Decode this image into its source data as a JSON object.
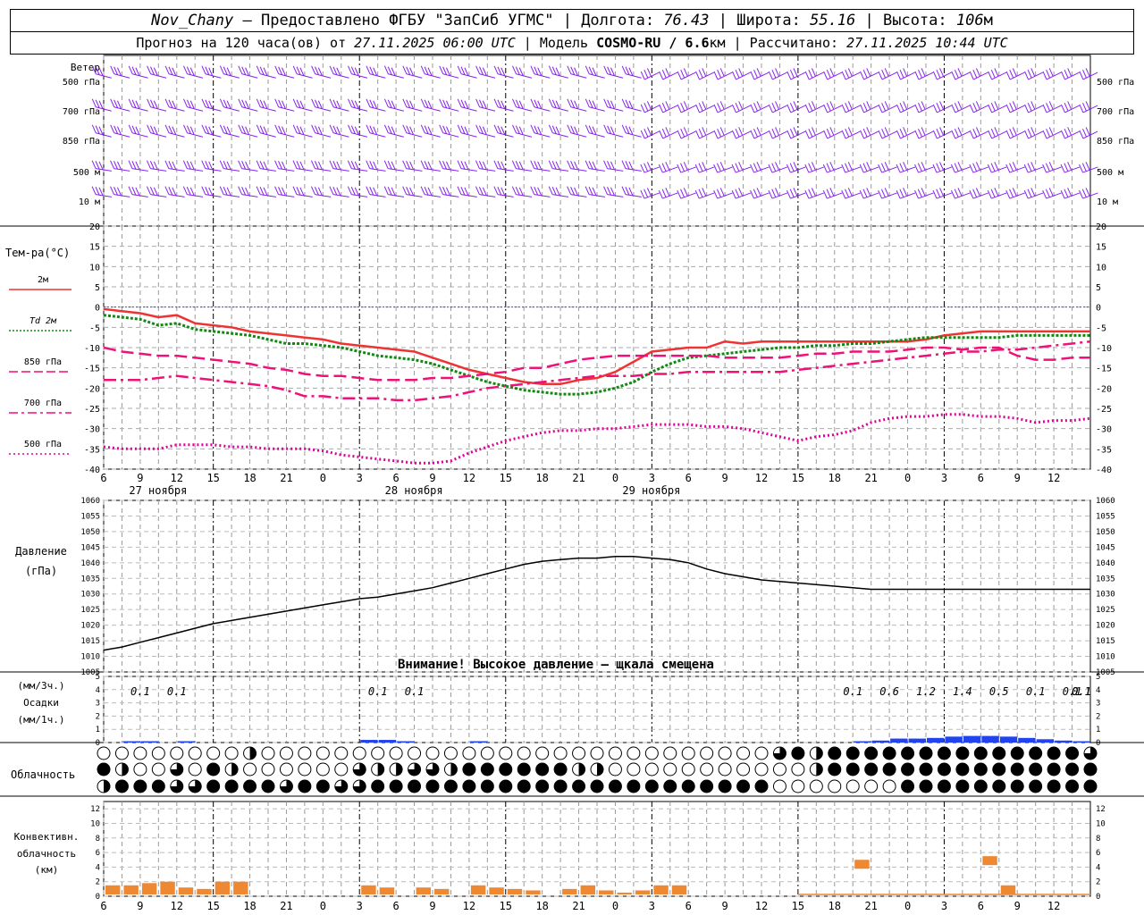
{
  "header": {
    "line1": {
      "station": "Nov_Chany",
      "t1": " — Предоставлено ФГБУ \"ЗапСиб УГМС\" | Долгота: ",
      "lon": "76.43",
      "t2": " | Широта: ",
      "lat": "55.16",
      "t3": " | Высота: ",
      "alt": "106",
      "t4": "м"
    },
    "line2": {
      "t1": "Прогноз на 120 часа(ов) от ",
      "issued": "27.11.2025 06:00 UTC",
      "t2": " | Модель ",
      "model": "COSMO-RU / 6.6",
      "t3": "км | Рассчитано: ",
      "computed": "27.11.2025 10:44 UTC"
    }
  },
  "labels": {
    "wind_title": "Ветер",
    "wind_levels": [
      "500 гПа",
      "700 гПа",
      "850 гПа",
      "500 м",
      "10 м"
    ],
    "temp_title": "Тем-ра(°C)",
    "temp_legend": [
      "2м",
      "Td 2м",
      "850 гПа",
      "700 гПа",
      "500 гПа"
    ],
    "pressure_title": [
      "Давление",
      "(гПа)"
    ],
    "pressure_warning": "Внимание! Высокое давление — щкала смещена",
    "precip_title": [
      "(мм/3ч.)",
      "Осадки",
      "(мм/1ч.)"
    ],
    "cloud_title": "Облачность",
    "conv_title": [
      "Конвективн.",
      "облачность",
      "(км)"
    ]
  },
  "colors": {
    "t2m": "#ee3333",
    "td2m": "#118811",
    "t850": "#ee1177",
    "t700": "#ee1177",
    "t500": "#dd0099",
    "wind": "#8822ee",
    "pressure": "#000000",
    "precip": "#2244ee",
    "convective": "#ee8833",
    "zero_line": "#3344ee"
  },
  "chart_data": {
    "type": "line",
    "x_ticks": [
      "6",
      "9",
      "12",
      "15",
      "18",
      "21",
      "0",
      "3",
      "6",
      "9",
      "12",
      "15",
      "18",
      "21",
      "0",
      "3",
      "6",
      "9",
      "12",
      "15",
      "18",
      "21",
      "0",
      "3",
      "6",
      "9",
      "12",
      "15",
      "18",
      "21",
      "0",
      "3",
      "6",
      "9",
      "12",
      "15",
      "18",
      "21",
      "0",
      "3",
      "6",
      "9",
      "12",
      "15",
      "18",
      "21",
      "0",
      "3",
      "6",
      "9",
      "12",
      "15",
      "18",
      "21",
      "0"
    ],
    "x_ticks_shown": [
      "6",
      "9",
      "12",
      "15",
      "18",
      "21",
      "0",
      "3",
      "6",
      "9",
      "12",
      "15",
      "18",
      "21",
      "0",
      "3",
      "6",
      "9",
      "12",
      "15",
      "18",
      "21",
      "0",
      "3",
      "6",
      "9",
      "12"
    ],
    "dates": [
      "27 ноября",
      "28 ноября",
      "29 ноября"
    ],
    "temperature": {
      "ylim": [
        -40,
        20
      ],
      "yticks": [
        20,
        15,
        10,
        5,
        0,
        -5,
        -10,
        -15,
        -20,
        -25,
        -30,
        -35,
        -40
      ],
      "series": [
        {
          "name": "2м",
          "values": [
            -0.5,
            -1,
            -1.5,
            -2.5,
            -2,
            -4,
            -4.5,
            -5,
            -6,
            -6.5,
            -7,
            -7.5,
            -8,
            -9,
            -9.5,
            -10,
            -10.5,
            -11,
            -12.5,
            -14,
            -15.5,
            -16.5,
            -17.5,
            -18.5,
            -19,
            -19,
            -18,
            -17.5,
            -16,
            -13.5,
            -11,
            -10.5,
            -10,
            -10,
            -8.5,
            -9,
            -8.5,
            -8.5,
            -8.5,
            -8.5,
            -8.5,
            -8.5,
            -8.5,
            -8.5,
            -8.5,
            -8,
            -7,
            -6.5,
            -6,
            -6,
            -6,
            -6,
            -6,
            -6,
            -6
          ]
        },
        {
          "name": "Td 2м",
          "values": [
            -2,
            -2.5,
            -3,
            -4.5,
            -4,
            -5.5,
            -6,
            -6.5,
            -7,
            -8,
            -9,
            -9,
            -9.5,
            -10,
            -11,
            -12,
            -12.5,
            -13,
            -14,
            -15.5,
            -17,
            -18.5,
            -19.5,
            -20.5,
            -21,
            -21.5,
            -21.5,
            -21,
            -20,
            -18.5,
            -16,
            -14,
            -12.5,
            -12,
            -11.5,
            -11,
            -10.5,
            -10,
            -10,
            -9.5,
            -9.5,
            -9,
            -9,
            -8.5,
            -8,
            -7.5,
            -7.5,
            -7.5,
            -7.5,
            -7.5,
            -7,
            -7,
            -7,
            -7,
            -7
          ]
        },
        {
          "name": "850 гПа",
          "values": [
            -10,
            -11,
            -11.5,
            -12,
            -12,
            -12.5,
            -13,
            -13.5,
            -14,
            -15,
            -15.5,
            -16.5,
            -17,
            -17,
            -17.5,
            -18,
            -18,
            -18,
            -17.5,
            -17.5,
            -17,
            -16.5,
            -16,
            -15,
            -15,
            -14,
            -13,
            -12.5,
            -12,
            -12,
            -12,
            -12,
            -12,
            -12,
            -12.5,
            -12.5,
            -12.5,
            -12.5,
            -12,
            -11.5,
            -11.5,
            -11,
            -11,
            -11,
            -10.5,
            -10,
            -10,
            -10.5,
            -10,
            -10,
            -12,
            -13,
            -13,
            -12.5,
            -12.5
          ]
        },
        {
          "name": "700 гПа",
          "values": [
            -18,
            -18,
            -18,
            -17.5,
            -17,
            -17.5,
            -18,
            -18.5,
            -19,
            -19.5,
            -20.5,
            -22,
            -22,
            -22.5,
            -22.5,
            -22.5,
            -23,
            -23,
            -22.5,
            -22,
            -21,
            -20,
            -19.5,
            -19,
            -18.5,
            -18,
            -17.5,
            -17,
            -17,
            -17,
            -16.5,
            -16.5,
            -16,
            -16,
            -16,
            -16,
            -16,
            -16,
            -15.5,
            -15,
            -14.5,
            -14,
            -13.5,
            -13,
            -12.5,
            -12,
            -11.5,
            -11,
            -11,
            -10.5,
            -10.5,
            -10,
            -9.5,
            -9,
            -8.5
          ]
        },
        {
          "name": "500 гПа",
          "values": [
            -34.5,
            -35,
            -35,
            -35,
            -34,
            -34,
            -34,
            -34.5,
            -34.5,
            -35,
            -35,
            -35,
            -35.5,
            -36.5,
            -37,
            -37.5,
            -38,
            -38.5,
            -38.5,
            -38,
            -36,
            -34.5,
            -33,
            -32,
            -31,
            -30.5,
            -30.5,
            -30,
            -30,
            -29.5,
            -29,
            -29,
            -29,
            -29.5,
            -29.5,
            -30,
            -31,
            -32,
            -33,
            -32,
            -31.5,
            -30.5,
            -28.5,
            -27.5,
            -27,
            -27,
            -26.5,
            -26.5,
            -27,
            -27,
            -27.5,
            -28.5,
            -28,
            -28,
            -27.5
          ]
        }
      ]
    },
    "pressure": {
      "ylim": [
        1005,
        1060
      ],
      "yticks": [
        1060,
        1055,
        1050,
        1045,
        1040,
        1035,
        1030,
        1025,
        1020,
        1015,
        1010,
        1005
      ],
      "values": [
        1012,
        1013,
        1014.5,
        1016,
        1017.5,
        1019,
        1020.5,
        1021.5,
        1022.5,
        1023.5,
        1024.5,
        1025.5,
        1026.5,
        1027.5,
        1028.5,
        1029,
        1030,
        1031,
        1032,
        1033.5,
        1035,
        1036.5,
        1038,
        1039.5,
        1040.5,
        1041,
        1041.5,
        1041.5,
        1042,
        1042,
        1041.5,
        1041,
        1040,
        1038,
        1036.5,
        1035.5,
        1034.5,
        1034,
        1033.5,
        1033,
        1032.5,
        1032,
        1031.5,
        1031.5,
        1031.5,
        1031.5,
        1031.5,
        1031.5,
        1031.5,
        1031.5,
        1031.5,
        1031.5,
        1031.5,
        1031.5,
        1031.5
      ]
    },
    "precip": {
      "ylim": [
        0,
        5
      ],
      "yticks": [
        5,
        4,
        3,
        2,
        1,
        0
      ],
      "values": [
        0,
        0.1,
        0.1,
        0,
        0.1,
        0,
        0,
        0,
        0,
        0,
        0,
        0,
        0,
        0,
        0.2,
        0.2,
        0.1,
        0,
        0,
        0,
        0.1,
        0,
        0,
        0,
        0,
        0,
        0,
        0,
        0,
        0,
        0,
        0,
        0,
        0,
        0,
        0,
        0,
        0,
        0,
        0,
        0,
        0.1,
        0.15,
        0.3,
        0.3,
        0.35,
        0.45,
        0.5,
        0.5,
        0.45,
        0.35,
        0.25,
        0.15,
        0.1,
        0.1
      ],
      "labels": [
        {
          "i": 2,
          "text": "0.1"
        },
        {
          "i": 4,
          "text": "0.1"
        },
        {
          "i": 15,
          "text": "0.1"
        },
        {
          "i": 17,
          "text": "0.1"
        },
        {
          "i": 41,
          "text": "0.1"
        },
        {
          "i": 43,
          "text": "0.6"
        },
        {
          "i": 45,
          "text": "1.2"
        },
        {
          "i": 47,
          "text": "1.4"
        },
        {
          "i": 49,
          "text": "0.5"
        },
        {
          "i": 51,
          "text": "0.1"
        },
        {
          "i": 53,
          "text": "0.1"
        },
        {
          "i": 55,
          "text": "0.1"
        },
        {
          "i": 57,
          "text": "0.1"
        },
        {
          "i": 59,
          "text": "0.1"
        }
      ]
    },
    "clouds": {
      "rows": [
        [
          0,
          0,
          0,
          0,
          0,
          0,
          0,
          0,
          2,
          0,
          0,
          0,
          0,
          0,
          0,
          0,
          0,
          0,
          0,
          0,
          0,
          0,
          0,
          0,
          0,
          0,
          0,
          0,
          0,
          0,
          0,
          0,
          0,
          0,
          0,
          0,
          0,
          3,
          4,
          2,
          4,
          4,
          4,
          4,
          4,
          4,
          4,
          4,
          4,
          4,
          4,
          4,
          4,
          4,
          3
        ],
        [
          4,
          2,
          0,
          0,
          3,
          0,
          4,
          2,
          0,
          0,
          0,
          0,
          0,
          0,
          3,
          2,
          2,
          3,
          3,
          2,
          4,
          4,
          4,
          4,
          4,
          4,
          2,
          2,
          0,
          0,
          0,
          0,
          0,
          0,
          0,
          0,
          0,
          0,
          0,
          2,
          4,
          4,
          4,
          4,
          4,
          4,
          4,
          4,
          4,
          4,
          4,
          4,
          4,
          4,
          4
        ],
        [
          2,
          4,
          4,
          4,
          3,
          3,
          4,
          4,
          4,
          4,
          3,
          4,
          4,
          3,
          3,
          4,
          4,
          4,
          4,
          4,
          4,
          4,
          4,
          4,
          4,
          4,
          4,
          4,
          4,
          4,
          4,
          4,
          4,
          4,
          4,
          4,
          4,
          0,
          0,
          0,
          0,
          0,
          0,
          0,
          4,
          4,
          4,
          4,
          4,
          4,
          4,
          4,
          4,
          4,
          4
        ]
      ]
    },
    "convective": {
      "ylim": [
        0,
        13
      ],
      "yticks": [
        12,
        10,
        8,
        6,
        4,
        2,
        0
      ],
      "values": [
        1.5,
        1.5,
        1.8,
        2,
        1.2,
        1,
        2,
        2,
        0,
        0,
        0,
        0,
        0,
        0,
        1.5,
        1.2,
        0,
        1.2,
        1,
        0,
        1.5,
        1.2,
        1,
        0.8,
        0,
        1,
        1.5,
        0.8,
        0.5,
        0.8,
        1.5,
        1.5,
        0,
        0,
        0,
        0,
        0,
        0,
        0,
        0,
        0,
        5,
        0,
        0,
        0,
        0,
        0,
        0,
        5.5,
        1.5,
        0,
        0,
        0,
        0,
        0
      ]
    }
  }
}
